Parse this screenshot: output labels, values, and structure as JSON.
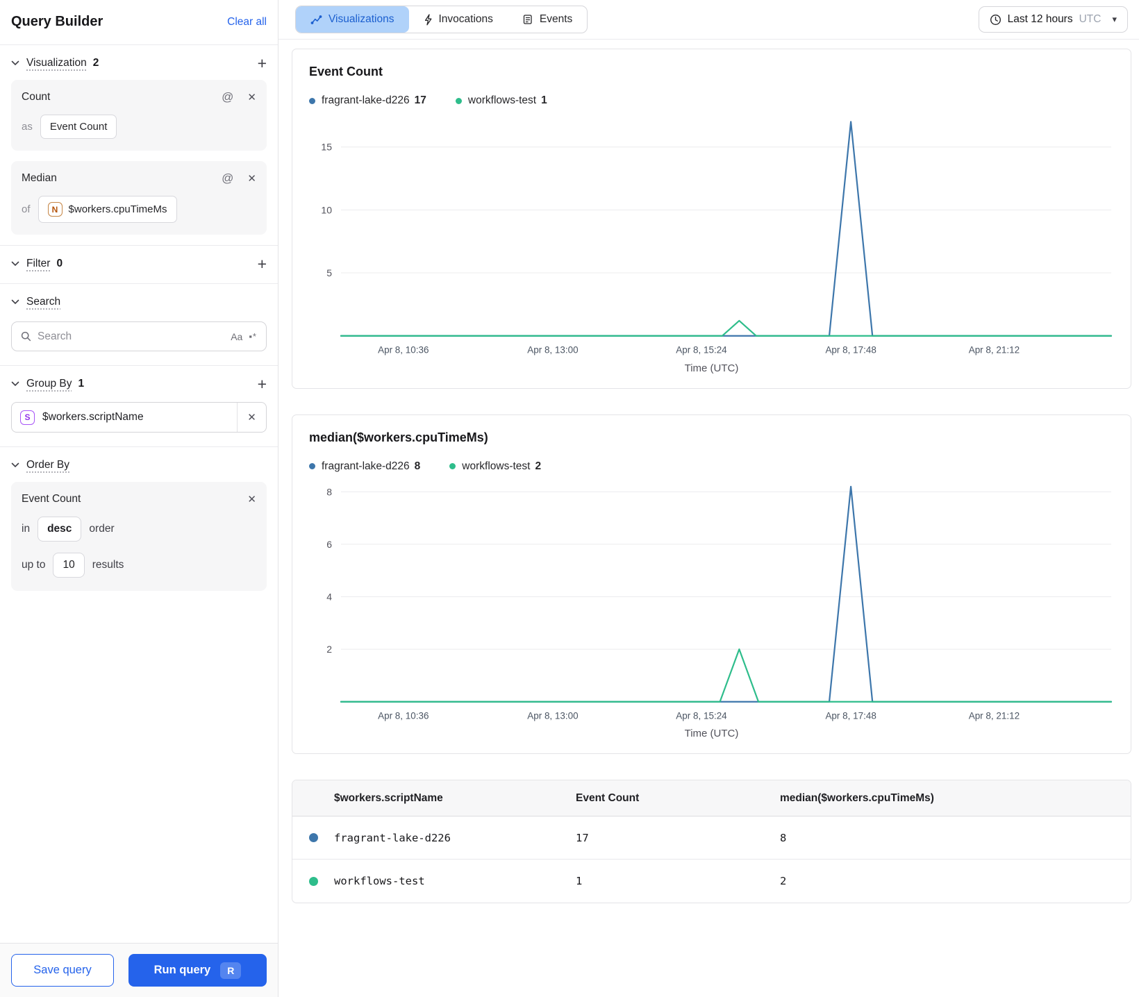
{
  "icons": {
    "add": "+",
    "close": "✕",
    "at": "@",
    "caret_down": "▾",
    "case_sensitive": "Aa",
    "regex": "▪*"
  },
  "colors": {
    "accent": "#2563eb",
    "series_blue": "#3d76ab",
    "series_green": "#2ebd8b",
    "tab_active_bg": "#b0d2fa"
  },
  "sidebar": {
    "title": "Query Builder",
    "clear_all": "Clear all",
    "visualization": {
      "label": "Visualization",
      "count": "2"
    },
    "viz_cards": [
      {
        "title": "Count",
        "prefix": "as",
        "value": "Event Count"
      },
      {
        "title": "Median",
        "prefix": "of",
        "badge": "N",
        "value": "$workers.cpuTimeMs"
      }
    ],
    "filter": {
      "label": "Filter",
      "count": "0"
    },
    "search": {
      "label": "Search",
      "placeholder": "Search"
    },
    "group_by": {
      "label": "Group By",
      "count": "1",
      "badge": "S",
      "value": "$workers.scriptName"
    },
    "order_by": {
      "label": "Order By",
      "field": "Event Count",
      "in_label": "in",
      "direction": "desc",
      "order_label": "order",
      "up_to_label": "up to",
      "limit": "10",
      "results_label": "results"
    },
    "save_button": "Save query",
    "run_button": "Run query",
    "run_shortcut": "R"
  },
  "header": {
    "tabs": [
      {
        "label": "Visualizations"
      },
      {
        "label": "Invocations"
      },
      {
        "label": "Events"
      }
    ],
    "time_range": {
      "label": "Last 12 hours",
      "timezone": "UTC"
    }
  },
  "chart_data": [
    {
      "type": "line",
      "title": "Event Count",
      "xlabel": "Time (UTC)",
      "ylabel": "",
      "ylim": [
        0,
        17.3
      ],
      "yticks": [
        5,
        10,
        15
      ],
      "grid": true,
      "legend_position": "top",
      "xticks": [
        {
          "label": "Apr 8, 10:36",
          "frac": 0.081
        },
        {
          "label": "Apr 8, 13:00",
          "frac": 0.275
        },
        {
          "label": "Apr 8, 15:24",
          "frac": 0.468
        },
        {
          "label": "Apr 8, 17:48",
          "frac": 0.662
        },
        {
          "label": "Apr 8, 21:12",
          "frac": 0.848
        }
      ],
      "legend": [
        {
          "name": "fragrant-lake-d226",
          "total": "17",
          "color": "#3d76ab"
        },
        {
          "name": "workflows-test",
          "total": "1",
          "color": "#2ebd8b"
        }
      ],
      "series": [
        {
          "name": "fragrant-lake-d226",
          "color": "#3d76ab",
          "points": [
            [
              0,
              0
            ],
            [
              0.634,
              0
            ],
            [
              0.662,
              17
            ],
            [
              0.69,
              0
            ],
            [
              1,
              0
            ]
          ]
        },
        {
          "name": "workflows-test",
          "color": "#2ebd8b",
          "points": [
            [
              0,
              0
            ],
            [
              0.495,
              0
            ],
            [
              0.517,
              1.2
            ],
            [
              0.539,
              0
            ],
            [
              1,
              0
            ]
          ]
        }
      ]
    },
    {
      "type": "line",
      "title": "median($workers.cpuTimeMs)",
      "xlabel": "Time (UTC)",
      "ylabel": "",
      "ylim": [
        0,
        8.3
      ],
      "yticks": [
        2,
        4,
        6,
        8
      ],
      "grid": true,
      "legend_position": "top",
      "xticks": [
        {
          "label": "Apr 8, 10:36",
          "frac": 0.081
        },
        {
          "label": "Apr 8, 13:00",
          "frac": 0.275
        },
        {
          "label": "Apr 8, 15:24",
          "frac": 0.468
        },
        {
          "label": "Apr 8, 17:48",
          "frac": 0.662
        },
        {
          "label": "Apr 8, 21:12",
          "frac": 0.848
        }
      ],
      "legend": [
        {
          "name": "fragrant-lake-d226",
          "total": "8",
          "color": "#3d76ab"
        },
        {
          "name": "workflows-test",
          "total": "2",
          "color": "#2ebd8b"
        }
      ],
      "series": [
        {
          "name": "fragrant-lake-d226",
          "color": "#3d76ab",
          "points": [
            [
              0,
              0
            ],
            [
              0.634,
              0
            ],
            [
              0.662,
              8.2
            ],
            [
              0.69,
              0
            ],
            [
              1,
              0
            ]
          ]
        },
        {
          "name": "workflows-test",
          "color": "#2ebd8b",
          "points": [
            [
              0,
              0
            ],
            [
              0.492,
              0
            ],
            [
              0.517,
              2
            ],
            [
              0.542,
              0
            ],
            [
              1,
              0
            ]
          ]
        }
      ]
    }
  ],
  "table": {
    "columns": [
      "$workers.scriptName",
      "Event Count",
      "median($workers.cpuTimeMs)"
    ],
    "rows": [
      {
        "color": "#3d76ab",
        "name": "fragrant-lake-d226",
        "event_count": "17",
        "median": "8"
      },
      {
        "color": "#2ebd8b",
        "name": "workflows-test",
        "event_count": "1",
        "median": "2"
      }
    ]
  }
}
